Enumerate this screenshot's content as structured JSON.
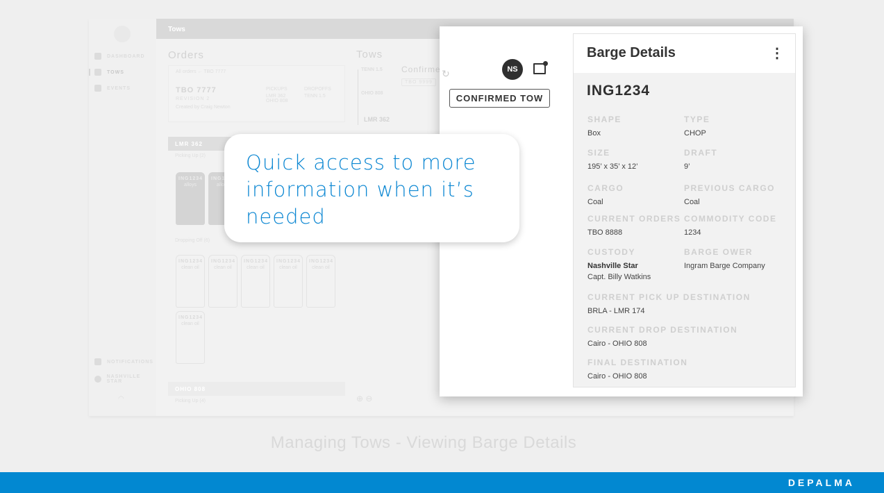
{
  "app": {
    "header_title": "Tows",
    "sidebar": {
      "items": [
        {
          "label": "DASHBOARD",
          "icon": "home-icon"
        },
        {
          "label": "TOWS",
          "icon": "grid-icon",
          "active": true
        },
        {
          "label": "EVENTS",
          "icon": "checkbox-icon"
        }
      ],
      "bottom": [
        {
          "label": "NOTIFICATIONS",
          "icon": "bell-icon"
        },
        {
          "label": "NASHVILLE STAR",
          "icon": "user-icon"
        }
      ]
    },
    "orders": {
      "title": "Orders",
      "breadcrumb": "All orders ← TBO 7777",
      "order_id": "TBO 7777",
      "revision": "REVISION 2",
      "created_by": "Created by Craig Newton",
      "pickups_label": "PICKUPS",
      "pickups": "LMR 362 OHIO 808",
      "dropoffs_label": "DROPOFFS",
      "dropoffs": "TENN 1.5",
      "section1": "LMR 362",
      "picking_up": "Picking Up (2)",
      "dropping_off": "Dropping Off (6)",
      "section2": "OHIO 808",
      "picking_up2": "Picking Up (4)",
      "picking_cards": [
        {
          "id": "ING1234",
          "cargo": "alloys"
        },
        {
          "id": "ING1234",
          "cargo": "alloys"
        }
      ],
      "dropping_cards": [
        {
          "id": "ING1234",
          "cargo": "clean oil"
        },
        {
          "id": "ING1234",
          "cargo": "clean oil"
        },
        {
          "id": "ING1234",
          "cargo": "clean oil"
        },
        {
          "id": "ING1234",
          "cargo": "clean oil"
        },
        {
          "id": "ING1234",
          "cargo": "clean oil"
        },
        {
          "id": "ING1234",
          "cargo": "clean oil"
        }
      ]
    },
    "tows": {
      "title": "Tows",
      "stops": [
        "TENN 1.5",
        "OHIO 808",
        "LMR 362"
      ],
      "confirmed_heading": "Confirme",
      "chip": "TBO 9999"
    }
  },
  "popup": {
    "avatar_initials": "NS",
    "confirmed_tow_label": "CONFIRMED TOW",
    "details": {
      "title": "Barge Details",
      "barge_id": "ING1234",
      "fields": [
        {
          "label": "SHAPE",
          "value": "Box"
        },
        {
          "label": "TYPE",
          "value": "CHOP"
        },
        {
          "label": "SIZE",
          "value": "195’ x 35’ x 12’"
        },
        {
          "label": "DRAFT",
          "value": "9’"
        },
        {
          "label": "CARGO",
          "value": "Coal"
        },
        {
          "label": "PREVIOUS CARGO",
          "value": "Coal"
        },
        {
          "label": "CURRENT ORDERS",
          "value": "TBO 8888"
        },
        {
          "label": "COMMODITY CODE",
          "value": "1234"
        },
        {
          "label": "CUSTODY",
          "value": "Nashville Star",
          "value2": "Capt. Billy Watkins"
        },
        {
          "label": "BARGE OWER",
          "value": "Ingram Barge Company"
        },
        {
          "label": "CURRENT PICK UP DESTINATION",
          "value": "BRLA - LMR 174"
        },
        {
          "label": "CURRENT DROP DESTINATION",
          "value": "Cairo - OHIO 808"
        },
        {
          "label": "FINAL DESTINATION",
          "value": "Cairo - OHIO 808"
        }
      ]
    }
  },
  "callout": {
    "text": "Quick access to more information when it’s needed"
  },
  "caption": "Managing Tows - Viewing Barge Details",
  "brand": "DEPALMA",
  "colors": {
    "accent": "#0288d1",
    "callout_text": "#0a86d2"
  }
}
